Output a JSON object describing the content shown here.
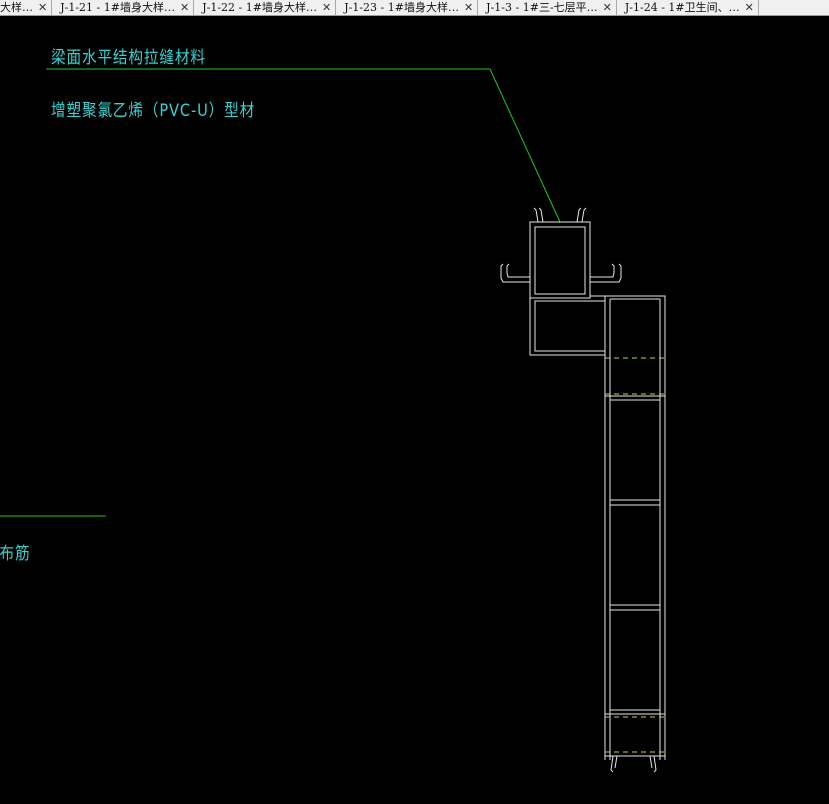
{
  "tabs": [
    {
      "label": "大样…",
      "close": "✕"
    },
    {
      "label": "J-1-21 - 1#墙身大样…",
      "close": "✕"
    },
    {
      "label": "J-1-22 - 1#墙身大样…",
      "close": "✕"
    },
    {
      "label": "J-1-23 - 1#墙身大样…",
      "close": "✕"
    },
    {
      "label": "J-1-3 - 1#三-七层平…",
      "close": "✕"
    },
    {
      "label": "J-1-24 - 1#卫生间、…",
      "close": "✕"
    }
  ],
  "annotations": {
    "label1": "梁面水平结构拉缝材料",
    "label2": "增塑聚氯乙烯（PVC-U）型材",
    "label3": "分布筋"
  },
  "colors": {
    "background": "#000000",
    "annotation_text": "#38d1d1",
    "leader_line": "#1ec81e",
    "profile_line": "#e6e6e6",
    "dashed_line": "#d6c84a",
    "tab_bar": "#f0f0f0"
  }
}
